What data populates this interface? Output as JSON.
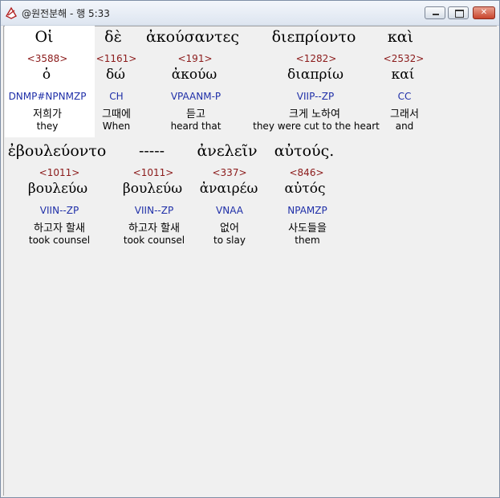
{
  "window": {
    "title": "@원전분해 - 행 5:33"
  },
  "line1": {
    "greek": [
      "Οἱ",
      "δὲ",
      "ἀκούσαντες",
      "διεπρίοντο",
      "καὶ"
    ],
    "words": [
      {
        "strong": "<3588>",
        "lemma": "ὁ",
        "morph": "DNMP#NPNMZP",
        "korean": "저희가",
        "english": "they"
      },
      {
        "strong": "<1161>",
        "lemma": "δώ",
        "morph": "CH",
        "korean": "그때에",
        "english": "When"
      },
      {
        "strong": "<191>",
        "lemma": "ἀκούω",
        "morph": "VPAANM-P",
        "korean": "듣고",
        "english": "heard that"
      },
      {
        "strong": "<1282>",
        "lemma": "διαπρίω",
        "morph": "VIIP--ZP",
        "korean": "크게 노하여",
        "english": "they were cut to the heart"
      },
      {
        "strong": "<2532>",
        "lemma": "καί",
        "morph": "CC",
        "korean": "그래서",
        "english": "and"
      }
    ]
  },
  "line2": {
    "greek": [
      "ἐβουλεύοντο",
      "-----",
      "ἀνελεῖν",
      "αὐτούς."
    ],
    "words": [
      {
        "strong": "<1011>",
        "lemma": "βουλεύω",
        "morph": "VIIN--ZP",
        "korean": "하고자 할새",
        "english": "took counsel"
      },
      {
        "strong": "<1011>",
        "lemma": "βουλεύω",
        "morph": "VIIN--ZP",
        "korean": "하고자 할새",
        "english": "took counsel"
      },
      {
        "strong": "<337>",
        "lemma": "ἀναιρέω",
        "morph": "VNAA",
        "korean": "없어",
        "english": "to slay"
      },
      {
        "strong": "<846>",
        "lemma": "αὐτός",
        "morph": "NPAMZP",
        "korean": "사도들을",
        "english": "them"
      }
    ]
  }
}
